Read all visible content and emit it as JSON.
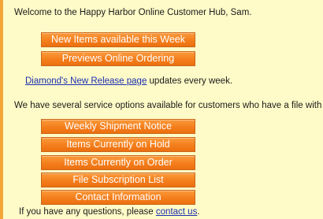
{
  "welcome_text": "Welcome to the Happy Harbor Online Customer Hub, Sam.",
  "top_buttons": [
    {
      "label": "New Items available this Week"
    },
    {
      "label": "Previews Online Ordering"
    }
  ],
  "diamond": {
    "link_text": "Diamond's New Release page",
    "suffix": " updates every week."
  },
  "service_intro": "We have several service options available for customers who have a file with us:",
  "service_buttons": [
    {
      "label": "Weekly Shipment Notice"
    },
    {
      "label": "Items Currently on Hold"
    },
    {
      "label": "Items Currently on Order"
    },
    {
      "label": "File Subscription List"
    },
    {
      "label": "Contact Information"
    }
  ],
  "footer": {
    "prefix": "If you have any questions, please ",
    "link_text": "contact us",
    "suffix": "."
  },
  "colors": {
    "background_frame": "#f2a63a",
    "panel": "#fffbc8",
    "button": "#f47e1c",
    "link": "#1a2fb0"
  }
}
